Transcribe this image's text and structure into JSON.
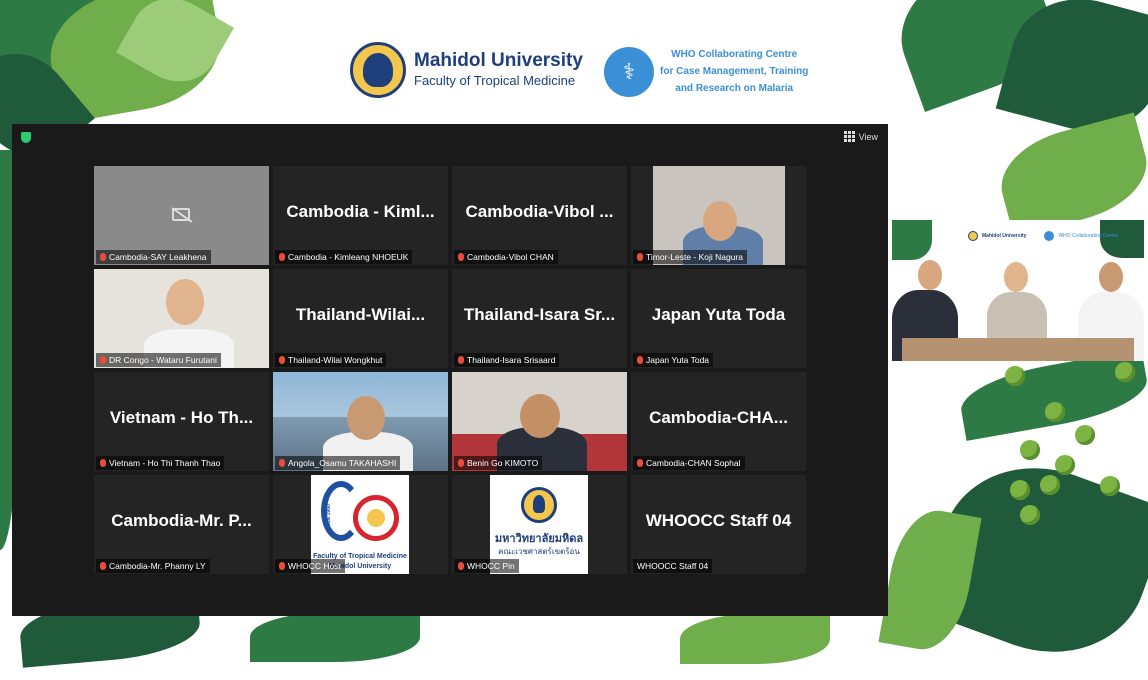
{
  "header": {
    "university_title": "Mahidol University",
    "university_sub": "Faculty of Tropical Medicine",
    "who_line1": "WHO Collaborating Centre",
    "who_line2": "for Case Management, Training",
    "who_line3": "and Research on Malaria",
    "seal_icon": "mahidol-seal-icon",
    "who_icon": "who-emblem-icon"
  },
  "meeting": {
    "view_label": "View",
    "tiles": [
      {
        "name": "",
        "label": "Cambodia-SAY Leakhena",
        "kind": "camera-off"
      },
      {
        "name": "Cambodia - Kiml...",
        "label": "Cambodia - Kimleang NHOEUK",
        "kind": "name"
      },
      {
        "name": "Cambodia-Vibol ...",
        "label": "Cambodia-Vibol CHAN",
        "kind": "name"
      },
      {
        "name": "",
        "label": "Timor-Leste - Koji Nagura",
        "kind": "video"
      },
      {
        "name": "",
        "label": "DR Congo - Wataru Furutani",
        "kind": "video"
      },
      {
        "name": "Thailand-Wilai...",
        "label": "Thailand-Wilai Wongkhut",
        "kind": "name"
      },
      {
        "name": "Thailand-Isara Sr...",
        "label": "Thailand-Isara Srisaard",
        "kind": "name"
      },
      {
        "name": "Japan Yuta Toda",
        "label": "Japan Yuta Toda",
        "kind": "name"
      },
      {
        "name": "Vietnam - Ho Th...",
        "label": "Vietnam - Ho Thi Thanh Thao",
        "kind": "name"
      },
      {
        "name": "",
        "label": "Angola_Osamu TAKAHASHI",
        "kind": "video"
      },
      {
        "name": "",
        "label": "Benin Go KIMOTO",
        "kind": "video"
      },
      {
        "name": "Cambodia-CHA...",
        "label": "Cambodia-CHAN Sophal",
        "kind": "name"
      },
      {
        "name": "Cambodia-Mr. P...",
        "label": "Cambodia-Mr. Phanny LY",
        "kind": "name"
      },
      {
        "name": "",
        "label": "WHOCC Host",
        "kind": "logo60"
      },
      {
        "name": "",
        "label": "WHOCC Pin",
        "kind": "logo-thai"
      },
      {
        "name": "WHOOCC Staff 04",
        "label": "WHOOCC Staff 04",
        "kind": "name"
      }
    ],
    "logo60_caption_1": "Faculty of Tropical Medicine",
    "logo60_caption_2": "Mahidol University",
    "logo60_since": "SINCE 1960",
    "logo_thai_1": "มหาวิทยาลัยมหิดล",
    "logo_thai_2": "คณะเวชศาสตร์เขตร้อน"
  },
  "panel": {
    "mini_title": "Mahidol University",
    "mini_who": "WHO Collaborating Centre"
  }
}
